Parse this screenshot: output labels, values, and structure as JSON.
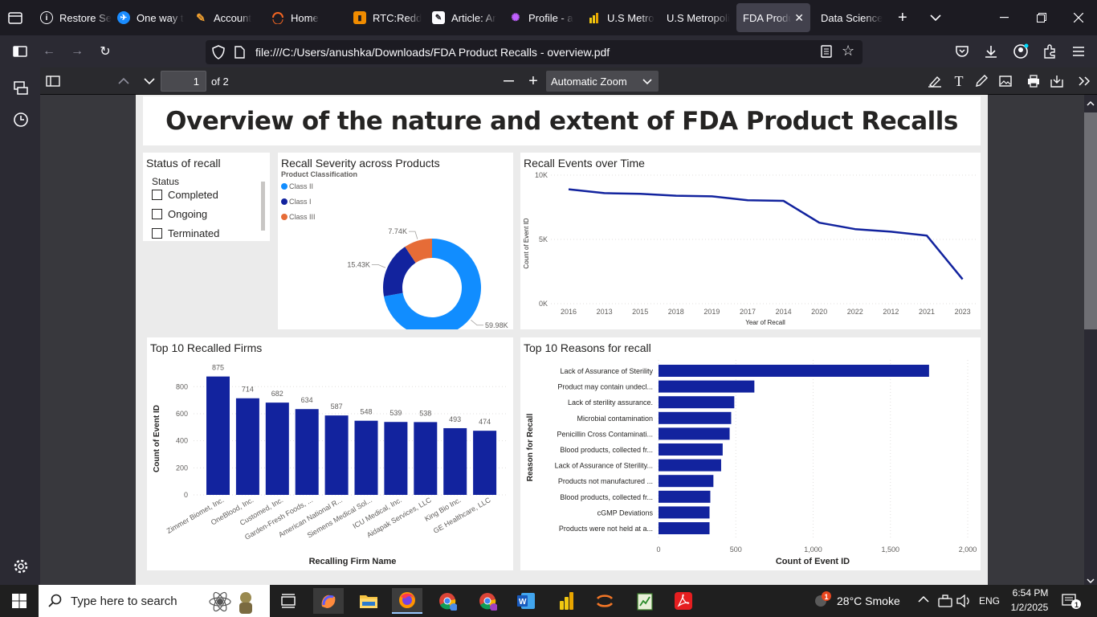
{
  "browser": {
    "tabs": [
      {
        "label": "Restore Se",
        "icon": "info-icon"
      },
      {
        "label": "One way t",
        "icon": "plane-icon"
      },
      {
        "label": "Account",
        "icon": "pen-icon"
      },
      {
        "label": "Home",
        "icon": "home-icon"
      },
      {
        "label": "RTC:Redd",
        "icon": "book-icon"
      },
      {
        "label": "Article: Ar",
        "icon": "article-icon"
      },
      {
        "label": "Profile - a",
        "icon": "profile-icon"
      },
      {
        "label": "U.S Metro",
        "icon": "chart-icon"
      },
      {
        "label": "U.S Metropoli",
        "icon": "none"
      },
      {
        "label": "FDA Produc",
        "icon": "none",
        "active": true
      },
      {
        "label": "Data Science",
        "icon": "none"
      }
    ],
    "url": "file:///C:/Users/anushka/Downloads/FDA Product Recalls - overview.pdf"
  },
  "pdf_toolbar": {
    "page_number": "1",
    "page_count": "of 2",
    "zoom": "Automatic Zoom"
  },
  "report": {
    "title": "Overview of the nature and extent of FDA Product Recalls",
    "slicer": {
      "title": "Status of recall",
      "header": "Status",
      "options": [
        "Completed",
        "Ongoing",
        "Terminated"
      ]
    },
    "donut": {
      "title": "Recall Severity across Products",
      "legend_title": "Product Classification"
    },
    "line": {
      "title": "Recall Events over Time"
    },
    "bars": {
      "title": "Top 10 Recalled Firms"
    },
    "hbars": {
      "title": "Top 10 Reasons for recall"
    }
  },
  "chart_data": [
    {
      "type": "pie",
      "title": "Recall Severity across Products",
      "legend_title": "Product Classification",
      "categories": [
        "Class II",
        "Class I",
        "Class III"
      ],
      "values": [
        59980,
        15430,
        7740
      ],
      "labels": [
        "59.98K",
        "15.43K",
        "7.74K"
      ],
      "colors": [
        "#118dff",
        "#12239e",
        "#e66c37"
      ]
    },
    {
      "type": "line",
      "title": "Recall Events over Time",
      "xlabel": "Year of Recall",
      "ylabel": "Count of Event ID",
      "x": [
        "2016",
        "2013",
        "2015",
        "2018",
        "2019",
        "2017",
        "2014",
        "2020",
        "2022",
        "2012",
        "2021",
        "2023"
      ],
      "values": [
        8900,
        8600,
        8550,
        8400,
        8350,
        8050,
        8000,
        6300,
        5800,
        5600,
        5300,
        1900
      ],
      "ylim": [
        0,
        10000
      ],
      "yticks": [
        "0K",
        "5K",
        "10K"
      ],
      "color": "#12239e"
    },
    {
      "type": "bar",
      "title": "Top 10 Recalled Firms",
      "xlabel": "Recalling Firm Name",
      "ylabel": "Count of Event ID",
      "categories": [
        "Zimmer Biomet, Inc.",
        "OneBlood, Inc.",
        "Customed, Inc.",
        "Garden-Fresh Foods, ...",
        "American National R...",
        "Siemens Medical Sol...",
        "ICU Medical, Inc.",
        "Aidapak Services, LLC",
        "King Bio Inc.",
        "GE Healthcare, LLC"
      ],
      "values": [
        875,
        714,
        682,
        634,
        587,
        548,
        539,
        538,
        493,
        474
      ],
      "ylim": [
        0,
        950
      ],
      "yticks": [
        "0",
        "200",
        "400",
        "600",
        "800"
      ],
      "color": "#12239e"
    },
    {
      "type": "bar",
      "orientation": "horizontal",
      "title": "Top 10 Reasons for recall",
      "xlabel": "Count of Event ID",
      "ylabel": "Reason for Recall",
      "categories": [
        "Lack of Assurance of Sterility",
        "Product may contain undecl...",
        "Lack of sterility assurance.",
        "Microbial contamination",
        "Penicillin Cross Contaminati...",
        "Blood products, collected fr...",
        "Lack of Assurance of Sterility...",
        "Products not manufactured ...",
        "Blood products, collected fr...",
        "cGMP Deviations",
        "Products were not held at a..."
      ],
      "values": [
        1750,
        620,
        490,
        470,
        460,
        415,
        405,
        355,
        335,
        330,
        330
      ],
      "xlim": [
        0,
        2000
      ],
      "xticks": [
        "0",
        "500",
        "1,000",
        "1,500",
        "2,000"
      ],
      "color": "#12239e"
    }
  ],
  "taskbar": {
    "search_placeholder": "Type here to search",
    "weather": "28°C  Smoke",
    "language": "ENG",
    "time": "6:54 PM",
    "date": "1/2/2025",
    "notification_count": "1"
  }
}
